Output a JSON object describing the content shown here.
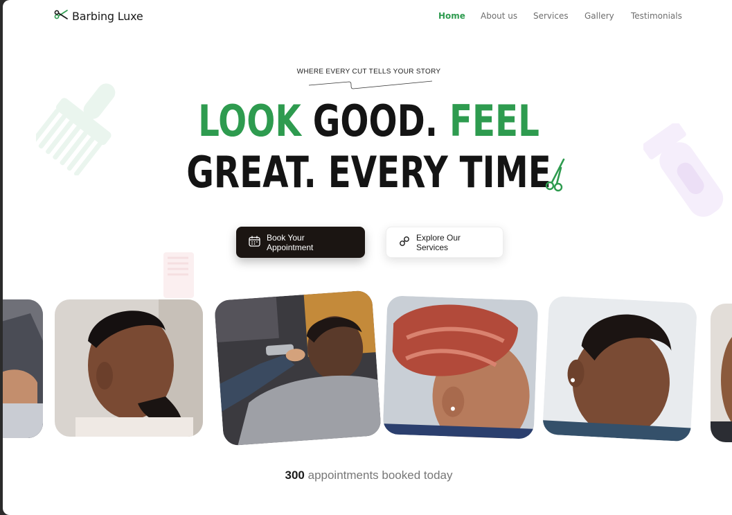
{
  "brand": {
    "name": "Barbing Luxe",
    "icon": "scissors-icon"
  },
  "nav": {
    "items": [
      {
        "label": "Home",
        "active": true
      },
      {
        "label": "About us",
        "active": false
      },
      {
        "label": "Services",
        "active": false
      },
      {
        "label": "Gallery",
        "active": false
      },
      {
        "label": "Testimonials",
        "active": false
      }
    ]
  },
  "hero": {
    "kicker": "WHERE EVERY CUT TELLS YOUR STORY",
    "headline": {
      "line1": [
        "LOOK",
        "GOOD.",
        "FEEL"
      ],
      "line2": [
        "GREAT.",
        "EVERY",
        "TIME"
      ]
    }
  },
  "buttons": {
    "primary": {
      "label": "Book Your Appointment",
      "icon": "calendar-icon"
    },
    "secondary": {
      "label": "Explore Our Services",
      "icon": "link-icon"
    }
  },
  "stats": {
    "count": "300",
    "label": "appointments booked today"
  },
  "colors": {
    "accent": "#2e9b4f",
    "dark": "#1b1512",
    "text": "#141414"
  }
}
